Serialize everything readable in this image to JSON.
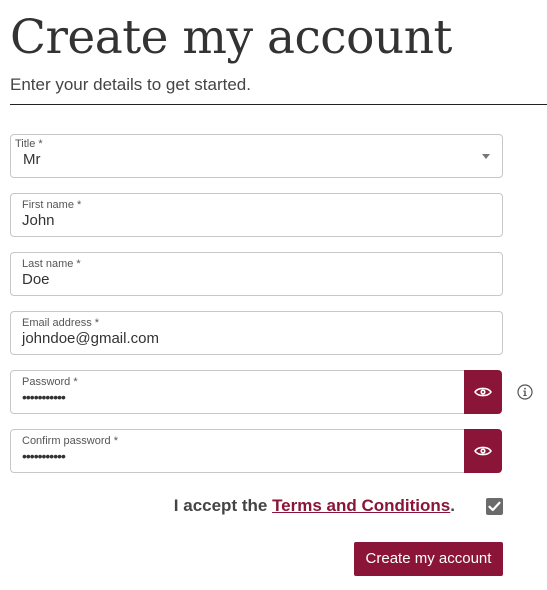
{
  "header": {
    "title": "Create my account",
    "subtitle": "Enter your details to get started."
  },
  "form": {
    "title": {
      "label": "Title *",
      "value": "Mr"
    },
    "first_name": {
      "label": "First name *",
      "value": "John"
    },
    "last_name": {
      "label": "Last name *",
      "value": "Doe"
    },
    "email": {
      "label": "Email address *",
      "value": "johndoe@gmail.com"
    },
    "password": {
      "label": "Password *",
      "value": "•••••••••••"
    },
    "confirm_password": {
      "label": "Confirm password *",
      "value": "•••••••••••"
    },
    "terms": {
      "prefix": "I accept the ",
      "link": "Terms and Conditions",
      "suffix": ".",
      "checked": true
    },
    "submit_label": "Create my account"
  },
  "icons": {
    "password_toggle": "eye-icon",
    "password_info": "info-icon",
    "select_caret": "caret-down-icon",
    "checkbox_mark": "check-icon"
  },
  "colors": {
    "accent": "#8a1538",
    "text": "#333333",
    "border": "#c7c7c7",
    "checkbox": "#6b6b6b"
  }
}
